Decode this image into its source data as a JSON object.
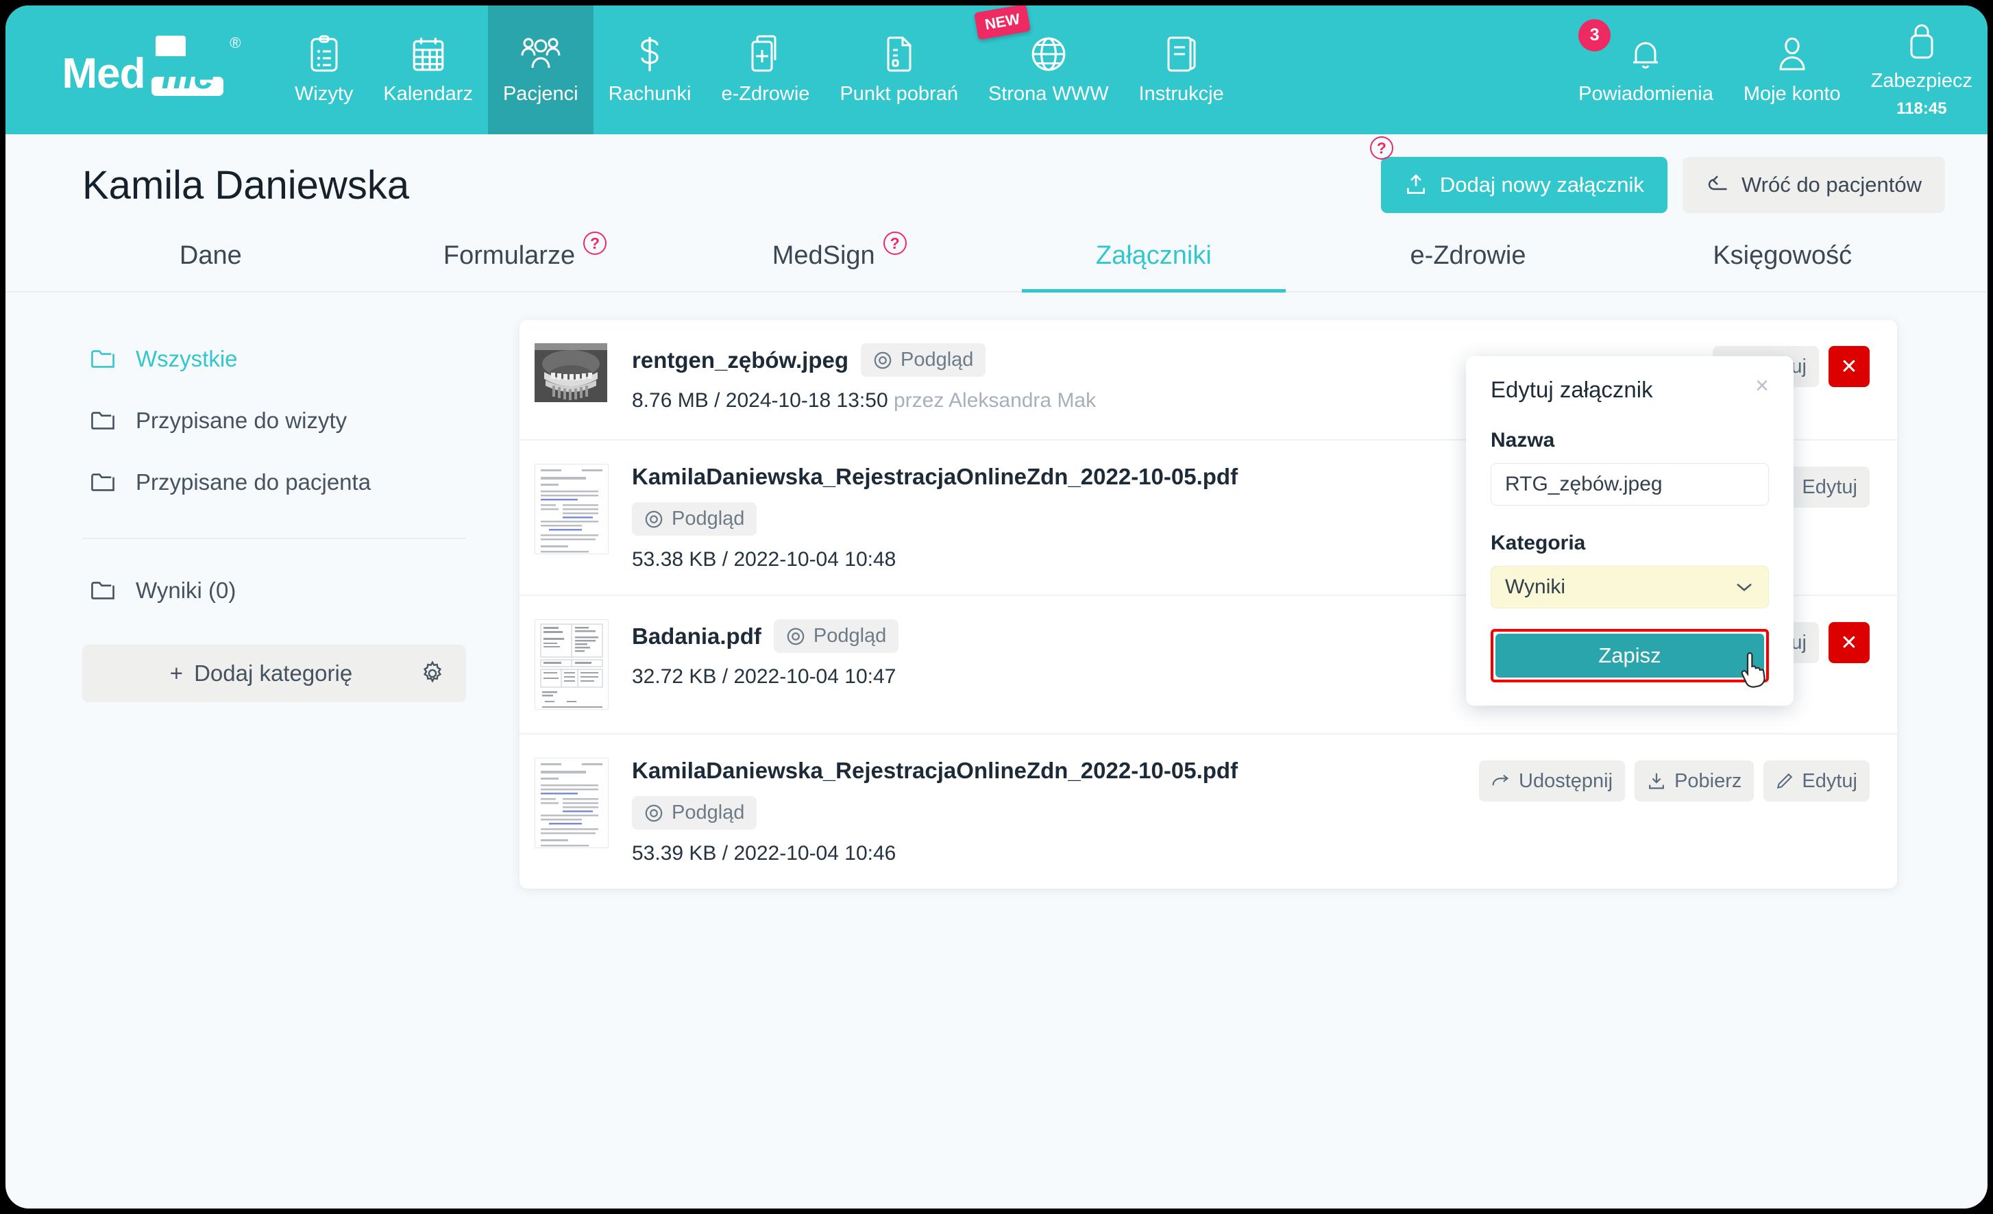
{
  "brand": {
    "name_part1": "Med",
    "name_part2": "file",
    "registered": "®",
    "teal": "#32c6cd",
    "teal_dark": "#2ba5ac",
    "pink": "#ef2a63",
    "red": "#dd0000"
  },
  "navbar": {
    "items": [
      {
        "label": "Wizyty",
        "icon": "clipboard-icon",
        "active": false
      },
      {
        "label": "Kalendarz",
        "icon": "calendar-icon",
        "active": false
      },
      {
        "label": "Pacjenci",
        "icon": "patients-icon",
        "active": true
      },
      {
        "label": "Rachunki",
        "icon": "dollar-icon",
        "active": false
      },
      {
        "label": "e-Zdrowie",
        "icon": "file-plus-icon",
        "active": false
      },
      {
        "label": "Punkt pobrań",
        "icon": "test-tube-icon",
        "active": false
      },
      {
        "label": "Strona WWW",
        "icon": "globe-icon",
        "active": false,
        "badge": "NEW"
      },
      {
        "label": "Instrukcje",
        "icon": "book-icon",
        "active": false
      }
    ],
    "right_items": [
      {
        "label": "Powiadomienia",
        "icon": "bell-icon",
        "count": "3"
      },
      {
        "label": "Moje konto",
        "icon": "user-icon"
      },
      {
        "label": "Zabezpiecz",
        "icon": "lock-icon",
        "sub": "118:45"
      }
    ]
  },
  "header": {
    "patient_name": "Kamila Daniewska",
    "add_attachment_label": "Dodaj nowy załącznik",
    "back_label": "Wróć do pacjentów",
    "help_mark": "?"
  },
  "tabs": [
    {
      "label": "Dane",
      "help": false,
      "active": false
    },
    {
      "label": "Formularze",
      "help": true,
      "active": false
    },
    {
      "label": "MedSign",
      "help": true,
      "active": false
    },
    {
      "label": "Załączniki",
      "help": false,
      "active": true
    },
    {
      "label": "e-Zdrowie",
      "help": false,
      "active": false
    },
    {
      "label": "Księgowość",
      "help": false,
      "active": false
    }
  ],
  "sidebar": {
    "folders": [
      {
        "label": "Wszystkie",
        "active": true
      },
      {
        "label": "Przypisane do wizyty",
        "active": false
      },
      {
        "label": "Przypisane do pacjenta",
        "active": false
      }
    ],
    "categories": [
      {
        "label": "Wyniki (0)",
        "active": false
      }
    ],
    "add_category_label": "Dodaj kategorię",
    "plus": "+"
  },
  "files": [
    {
      "name": "rentgen_zębów.jpeg",
      "preview_label": "Podgląd",
      "size": "8.76 MB",
      "separator": "/",
      "date": "2024-10-18 13:50",
      "by": "przez Aleksandra Mak",
      "thumb": "xray",
      "actions": [
        "Edytuj"
      ],
      "has_delete": true,
      "layout": "inline"
    },
    {
      "name": "KamilaDaniewska_RejestracjaOnlineZdn_2022-10-05.pdf",
      "preview_label": "Podgląd",
      "size": "53.38 KB",
      "separator": "/",
      "date": "2022-10-04 10:48",
      "by": "",
      "thumb": "doc",
      "actions": [
        "Edytuj"
      ],
      "has_delete": false,
      "layout": "stacked"
    },
    {
      "name": "Badania.pdf",
      "preview_label": "Podgląd",
      "size": "32.72 KB",
      "separator": "/",
      "date": "2022-10-04 10:47",
      "by": "",
      "thumb": "lab",
      "actions": [
        "Edytuj"
      ],
      "has_delete": true,
      "layout": "inline"
    },
    {
      "name": "KamilaDaniewska_RejestracjaOnlineZdn_2022-10-05.pdf",
      "preview_label": "Podgląd",
      "size": "53.39 KB",
      "separator": "/",
      "date": "2022-10-04 10:46",
      "by": "",
      "thumb": "doc",
      "actions": [
        "Udostępnij",
        "Pobierz",
        "Edytuj"
      ],
      "has_delete": false,
      "layout": "stacked"
    }
  ],
  "modal": {
    "title": "Edytuj załącznik",
    "close": "×",
    "name_label": "Nazwa",
    "name_value": "RTG_zębów.jpeg",
    "name_placeholder": "Nazwa",
    "category_label": "Kategoria",
    "category_value": "Wyniki",
    "save_label": "Zapisz",
    "chevron": "⌄"
  }
}
